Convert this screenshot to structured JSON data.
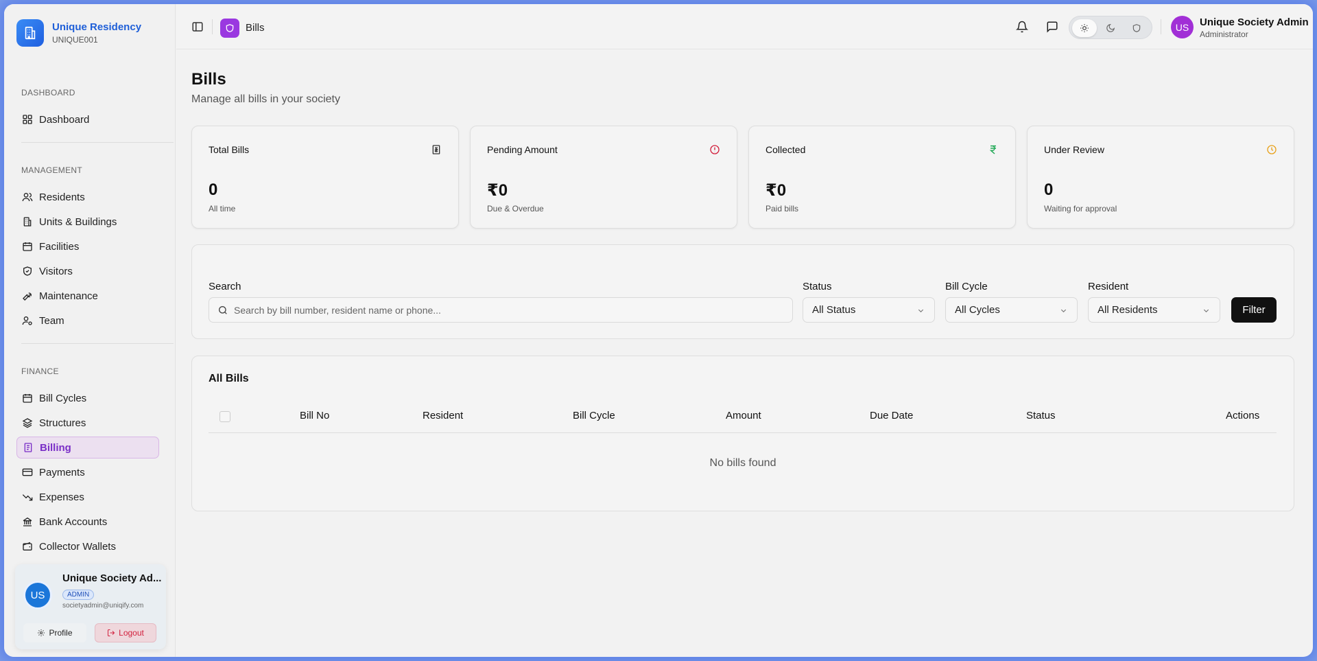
{
  "brand": {
    "name": "Unique Residency",
    "code": "UNIQUE001"
  },
  "sidebar": {
    "sections": {
      "dashboard": "DASHBOARD",
      "management": "MANAGEMENT",
      "finance": "FINANCE"
    },
    "items": {
      "dashboard": "Dashboard",
      "residents": "Residents",
      "units": "Units & Buildings",
      "facilities": "Facilities",
      "visitors": "Visitors",
      "maintenance": "Maintenance",
      "team": "Team",
      "bill_cycles": "Bill Cycles",
      "structures": "Structures",
      "billing": "Billing",
      "payments": "Payments",
      "expenses": "Expenses",
      "bank_accounts": "Bank Accounts",
      "collector_wallets": "Collector Wallets"
    },
    "active_item": "billing"
  },
  "user_card": {
    "initials": "US",
    "name": "Unique Society Ad...",
    "badge": "ADMIN",
    "email": "societyadmin@uniqify.com",
    "profile_label": "Profile",
    "logout_label": "Logout"
  },
  "topbar": {
    "page": "Bills",
    "theme_selected": "light",
    "user": {
      "initials": "US",
      "name": "Unique Society Admin",
      "role": "Administrator"
    }
  },
  "page": {
    "title": "Bills",
    "subtitle": "Manage all bills in your society"
  },
  "stats": [
    {
      "title": "Total Bills",
      "value": "0",
      "note": "All time",
      "icon": "bill-icon"
    },
    {
      "title": "Pending Amount",
      "value": "₹0",
      "note": "Due & Overdue",
      "icon": "alert-circle-icon"
    },
    {
      "title": "Collected",
      "value": "₹0",
      "note": "Paid bills",
      "icon": "rupee-icon"
    },
    {
      "title": "Under Review",
      "value": "0",
      "note": "Waiting for approval",
      "icon": "clock-icon"
    }
  ],
  "filters": {
    "search_label": "Search",
    "search_placeholder": "Search by bill number, resident name or phone...",
    "status_label": "Status",
    "status_value": "All Status",
    "cycle_label": "Bill Cycle",
    "cycle_value": "All Cycles",
    "resident_label": "Resident",
    "resident_value": "All Residents",
    "button": "Filter"
  },
  "table": {
    "title": "All Bills",
    "columns": [
      "Bill No",
      "Resident",
      "Bill Cycle",
      "Amount",
      "Due Date",
      "Status",
      "Actions"
    ],
    "rows": [],
    "empty": "No bills found"
  },
  "colors": {
    "accent": "#9a38e0",
    "brand": "#1f5fd8",
    "danger": "#d21f3c",
    "success": "#1fa855",
    "warning": "#e8a11a"
  }
}
